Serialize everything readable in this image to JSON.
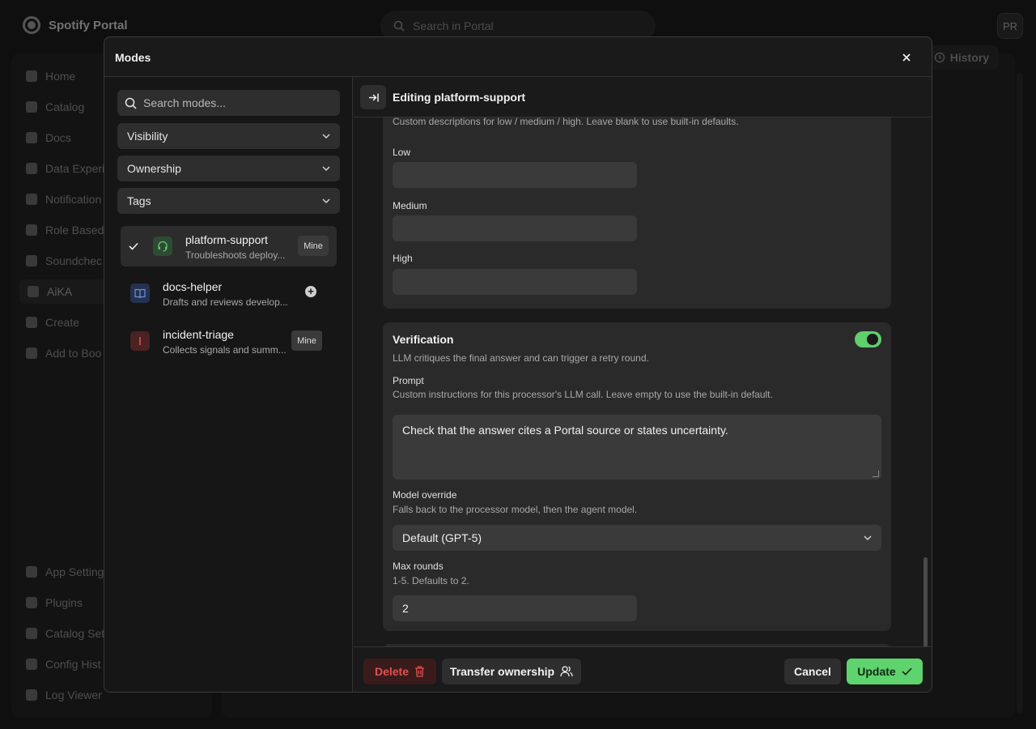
{
  "app": {
    "brand": "Spotify Portal",
    "search_placeholder": "Search in Portal",
    "avatar_initials": "PR",
    "history_label": "History",
    "sidebar": {
      "top_items": [
        "Home",
        "Catalog",
        "Docs",
        "Data Experi",
        "Notification",
        "Role Based",
        "Soundchec",
        "AiKA",
        "Create",
        "Add to Boo"
      ],
      "active_index": 7,
      "bottom_items": [
        "App Setting",
        "Plugins",
        "Catalog Set",
        "Config Hist",
        "Log Viewer"
      ]
    }
  },
  "modal": {
    "title": "Modes",
    "search_placeholder": "Search modes...",
    "filters": [
      "Visibility",
      "Ownership",
      "Tags"
    ],
    "modes": [
      {
        "name": "platform-support",
        "description": "Troubleshoots deploy...",
        "badge": "Mine",
        "selected": true,
        "icon": "headset-icon",
        "color": "#5fcf6c"
      },
      {
        "name": "docs-helper",
        "description": "Drafts and reviews develop...",
        "badge": "",
        "selected": false,
        "icon": "book-icon",
        "color": "#6a8fe0"
      },
      {
        "name": "incident-triage",
        "description": "Collects signals and summ...",
        "badge": "Mine",
        "selected": false,
        "icon": "alert-icon",
        "color": "#e0514e"
      }
    ],
    "editor": {
      "title": "Editing platform-support",
      "levels": {
        "hint": "Custom descriptions for low / medium / high. Leave blank to use built-in defaults.",
        "low_label": "Low",
        "medium_label": "Medium",
        "high_label": "High",
        "low_value": "",
        "medium_value": "",
        "high_value": ""
      },
      "verification": {
        "title": "Verification",
        "enabled": true,
        "description": "LLM critiques the final answer and can trigger a retry round.",
        "prompt_label": "Prompt",
        "prompt_hint": "Custom instructions for this processor's LLM call. Leave empty to use the built-in default.",
        "prompt_value": "Check that the answer cites a Portal source or states uncertainty.",
        "model_label": "Model override",
        "model_hint": "Falls back to the processor model, then the agent model.",
        "model_value": "Default (GPT-5)",
        "rounds_label": "Max rounds",
        "rounds_hint": "1-5. Defaults to 2.",
        "rounds_value": "2"
      }
    },
    "footer": {
      "delete_label": "Delete",
      "transfer_label": "Transfer ownership",
      "cancel_label": "Cancel",
      "update_label": "Update"
    }
  }
}
